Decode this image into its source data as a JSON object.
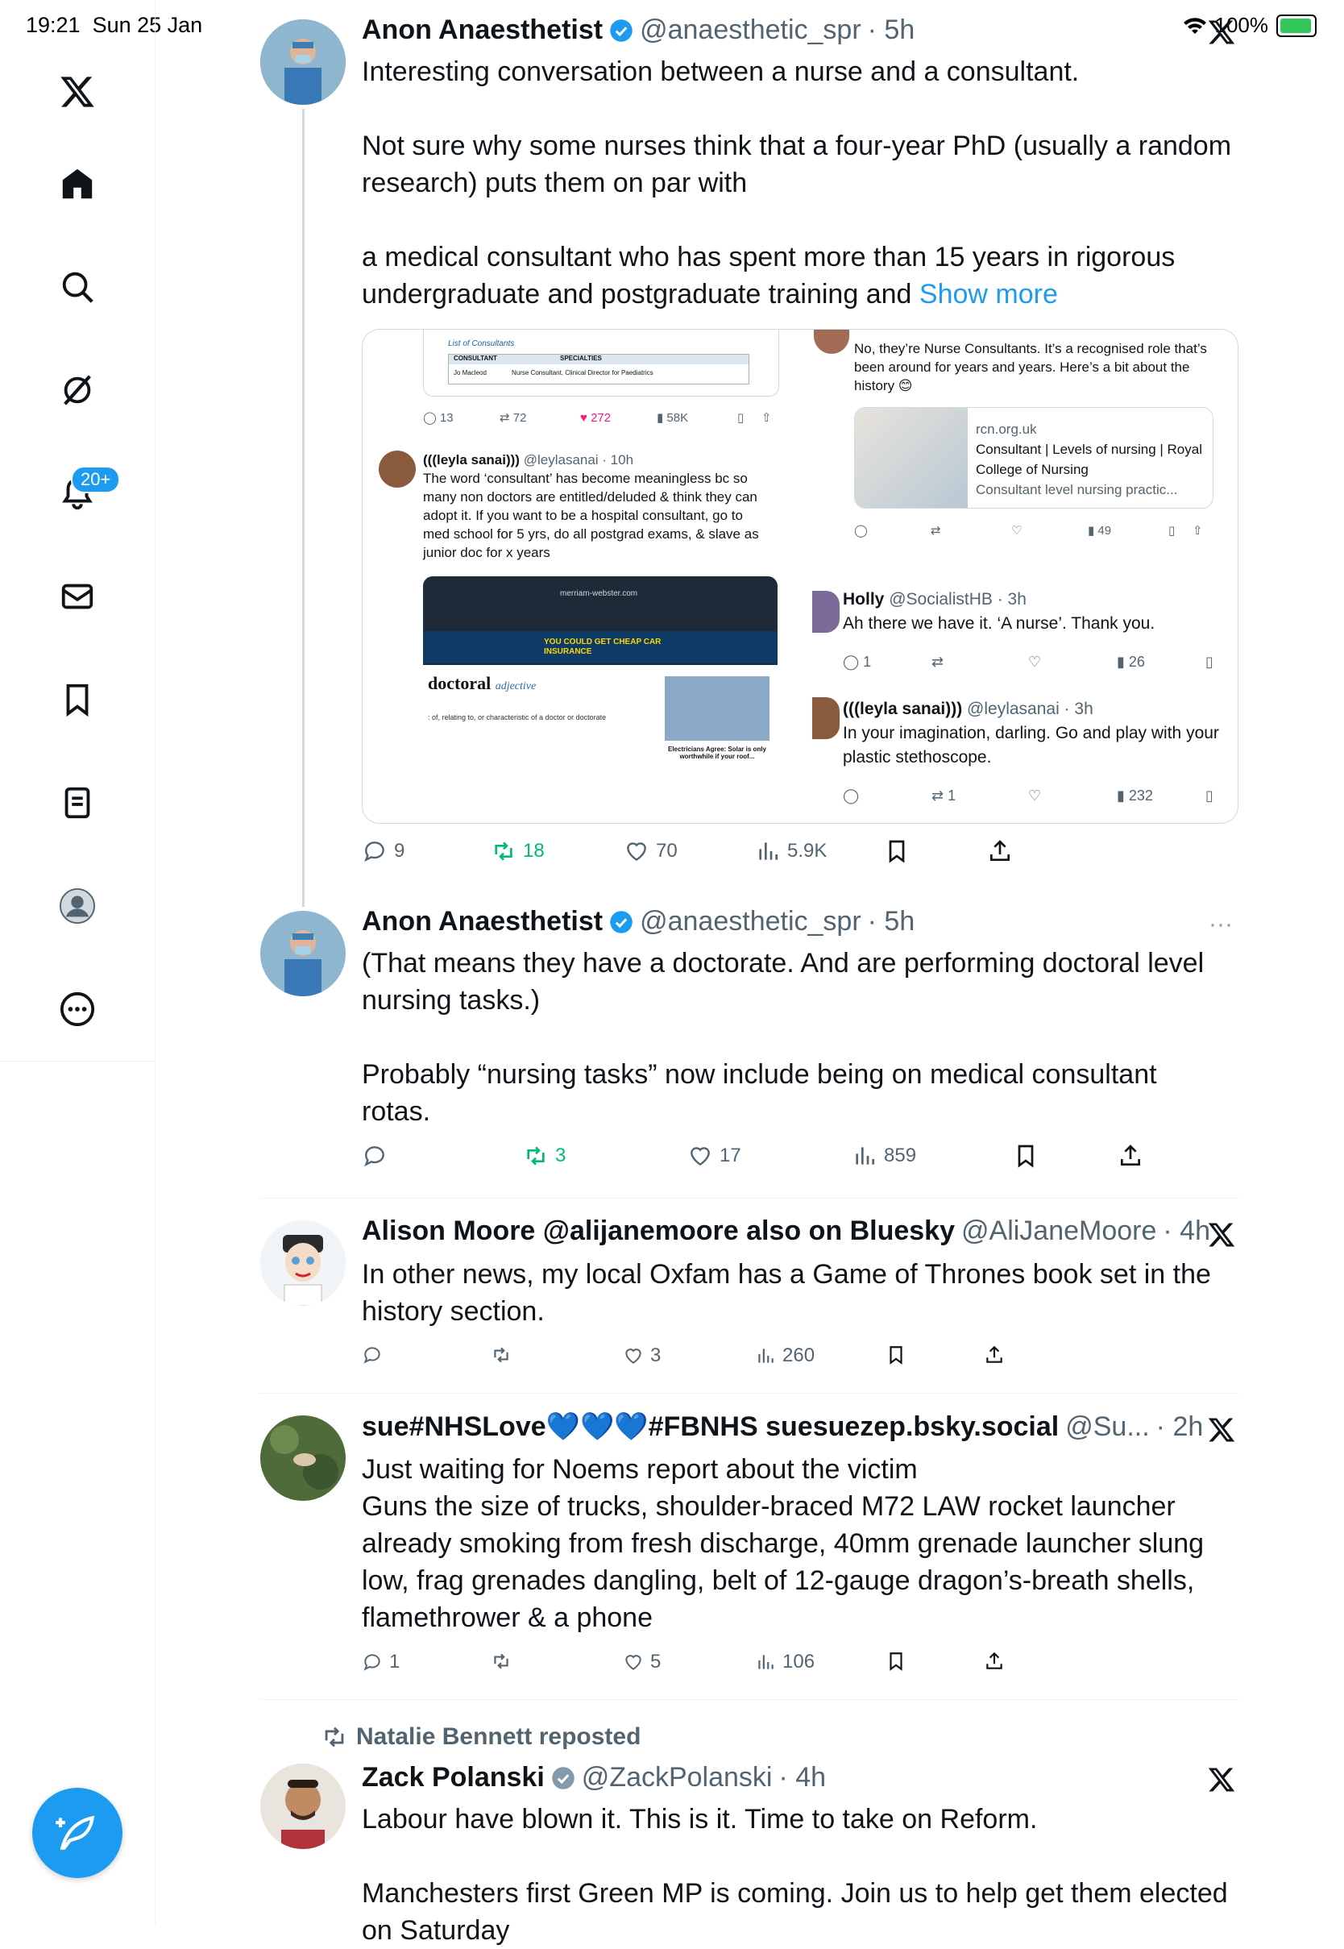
{
  "status_bar": {
    "time": "19:21",
    "date": "Sun 25 Jan",
    "battery": "100%"
  },
  "sidebar": {
    "notifications_badge": "20+"
  },
  "tweets": [
    {
      "name": "Anon Anaesthetist",
      "handle": "@anaesthetic_spr",
      "time": "· 5h",
      "text_lines": [
        "Interesting conversation between a nurse and a consultant.",
        "",
        "Not sure why some nurses think that a four-year PhD (usually a random",
        "research) puts them on par with",
        "",
        "a medical consultant who has spent more than 15 years in rigorous",
        "undergraduate and postgraduate training and"
      ],
      "show_more": "Show more",
      "replies": "9",
      "reposts": "18",
      "likes": "70",
      "views": "5.9K"
    },
    {
      "name": "Anon Anaesthetist",
      "handle": "@anaesthetic_spr",
      "time": "· 5h",
      "text_lines": [
        "(That means they have a doctorate. And are performing doctoral level",
        "nursing tasks.)",
        "",
        "Probably “nursing tasks” now include being on medical consultant",
        "rotas."
      ],
      "replies": "",
      "reposts": "3",
      "likes": "17",
      "views": "859"
    },
    {
      "name": "Alison Moore @alijanemoore also on Bluesky",
      "handle": "@AliJaneMoore",
      "time": "· 4h",
      "text_lines": [
        "In other news, my local Oxfam has a Game of Thrones book set in the",
        "history section."
      ],
      "replies": "",
      "reposts": "",
      "likes": "3",
      "views": "260"
    },
    {
      "name": "sue#NHSLove💙💙💙#FBNHS suesuezep.bsky.social",
      "handle": "@Su...",
      "time": "· 2h",
      "text_lines": [
        "Just waiting for Noems report about the victim",
        "Guns the size of trucks, shoulder-braced M72 LAW rocket launcher",
        "already smoking from fresh discharge, 40mm grenade launcher slung",
        "low, frag grenades dangling, belt of 12-gauge dragon’s-breath shells,",
        "flamethrower  & a phone"
      ],
      "replies": "1",
      "reposts": "",
      "likes": "5",
      "views": "106"
    },
    {
      "repost_label": "Natalie Bennett reposted",
      "name": "Zack Polanski",
      "handle": "@ZackPolanski",
      "time": "· 4h",
      "text_lines": [
        "Labour have blown it. This is it. Time to take on Reform.",
        "",
        "Manchesters first Green MP is coming. Join us to help get them elected",
        "on Saturday"
      ]
    }
  ],
  "media": {
    "top_left": {
      "table_caption": "List of Consultants",
      "col1": "CONSULTANT",
      "col2": "SPECIALTIES",
      "row_name": "Jo Macleod",
      "row_spec": "Nurse Consultant, Clinical Director for Paediatrics",
      "replies": "13",
      "reposts": "72",
      "likes": "272",
      "views": "58K"
    },
    "leyla1": {
      "name": "(((leyla sanai)))",
      "handle": "@leylasanai · 10h",
      "text": "The word ‘consultant’ has become meaningless bc so many non doctors are entitled/deluded & think they can adopt it. If you want to be a hospital consultant, go to med school for 5 yrs, do all postgrad exams, & slave as junior doc for x years"
    },
    "holly1": {
      "text": "No, they’re Nurse Consultants. It’s a recognised role that’s been around for years and years. Here’s a bit about the history 😊",
      "card_domain": "rcn.org.uk",
      "card_title": "Consultant | Levels of nursing | Royal College of Nursing",
      "card_desc": "Consultant level nursing practic...",
      "views": "49"
    },
    "dictionary": {
      "site": "merriam-webster.com",
      "ad_text": "YOU COULD GET CHEAP CAR INSURANCE",
      "word": "doctoral",
      "pos": "adjective",
      "definition": ": of, relating to, or characteristic of a doctor or doctorate",
      "ad2": "Electricians Agree: Solar is only worthwhile if your roof..."
    },
    "holly2": {
      "name": "Holly",
      "handle": "@SocialistHB · 3h",
      "text": "Ah there we have it. ‘A nurse’. Thank you.",
      "replies": "1",
      "views": "26"
    },
    "leyla2": {
      "name": "(((leyla sanai)))",
      "handle": "@leylasanai · 3h",
      "text": "In your imagination, darling. Go and play with your plastic stethoscope.",
      "reposts": "1",
      "views": "232"
    }
  }
}
